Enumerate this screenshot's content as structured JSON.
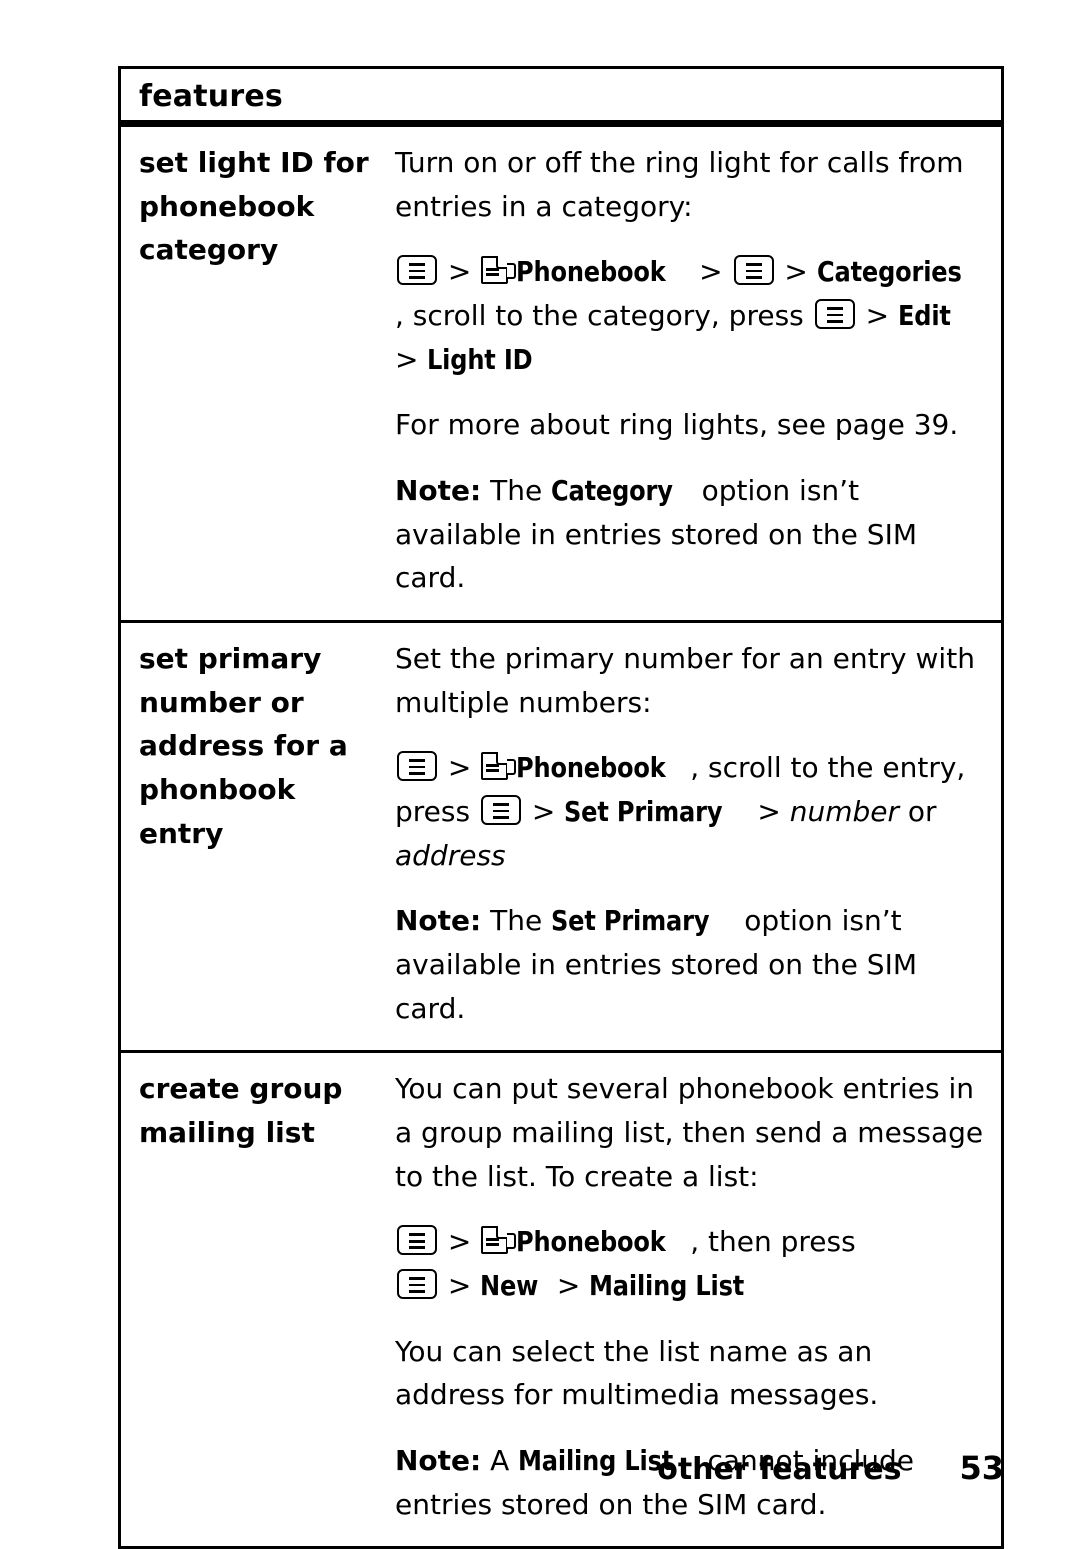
{
  "table": {
    "header": "features",
    "rows": [
      {
        "term": "set light ID for phonebook category",
        "lines": [
          "Turn on or off the ring light for calls from entries in a category:",
          "For more about ring lights, see page 39.",
          "Note:",
          "The",
          "Category",
          "option isn’t available in entries stored on the SIM card."
        ],
        "path": {
          "phonebook": "Phonebook",
          "categories": "Categories",
          "scroll_text": ", scroll to the category, press",
          "edit": "Edit",
          "light_id": "Light ID",
          "gt": ">"
        }
      },
      {
        "term": "set primary number or address for a phonbook entry",
        "lines": [
          "Set the primary number for an entry with multiple numbers:",
          "Note:",
          "The",
          "Set Primary",
          "option isn’t available in entries stored on the SIM card."
        ],
        "path": {
          "phonebook": "Phonebook",
          "scroll_text": ", scroll to the entry, press",
          "set_primary": "Set Primary",
          "number": "number",
          "or": "or",
          "address": "address",
          "gt": ">"
        }
      },
      {
        "term": "create group mailing list",
        "lines": [
          "You can put several phonebook entries in a group mailing list, then send a message to the list. To create a list:",
          "You can select the list name as an address for multimedia messages.",
          "Note:",
          "A",
          "Mailing List",
          "cannot include entries stored on the SIM card."
        ],
        "path": {
          "phonebook": "Phonebook",
          "then_press": ", then press",
          "new": "New",
          "mailing_list": "Mailing List",
          "gt": ">"
        }
      }
    ]
  },
  "footer": {
    "label": "other features",
    "page_number": "53"
  }
}
